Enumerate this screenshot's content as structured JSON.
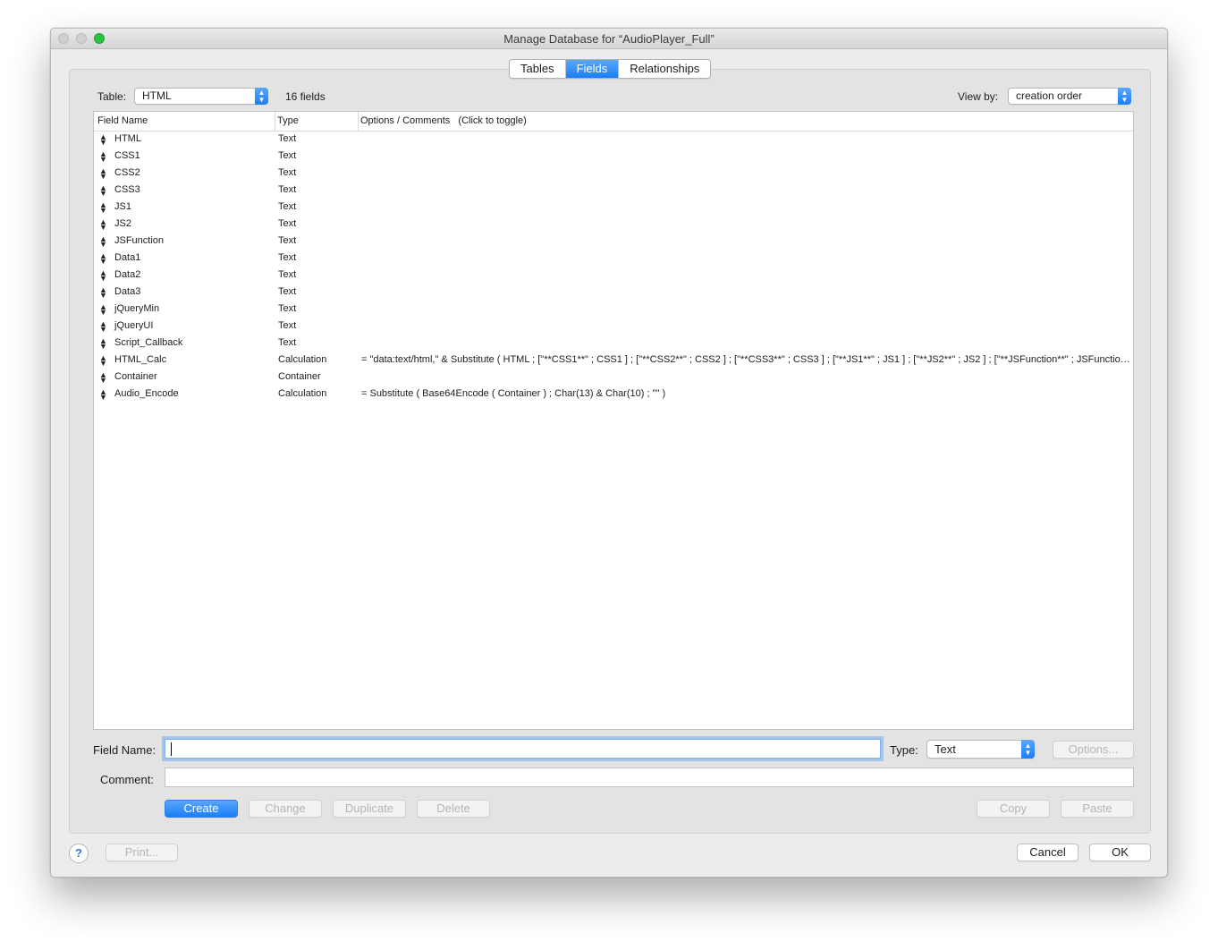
{
  "window": {
    "title": "Manage Database for “AudioPlayer_Full”"
  },
  "tabs": [
    {
      "label": "Tables",
      "active": false
    },
    {
      "label": "Fields",
      "active": true
    },
    {
      "label": "Relationships",
      "active": false
    }
  ],
  "toolbar": {
    "table_label": "Table:",
    "table_value": "HTML",
    "field_count": "16 fields",
    "viewby_label": "View by:",
    "viewby_value": "creation order"
  },
  "columns": {
    "name": "Field Name",
    "type": "Type",
    "options": "Options / Comments   (Click to toggle)"
  },
  "fields": [
    {
      "name": "HTML",
      "type": "Text",
      "options": ""
    },
    {
      "name": "CSS1",
      "type": "Text",
      "options": ""
    },
    {
      "name": "CSS2",
      "type": "Text",
      "options": ""
    },
    {
      "name": "CSS3",
      "type": "Text",
      "options": ""
    },
    {
      "name": "JS1",
      "type": "Text",
      "options": ""
    },
    {
      "name": "JS2",
      "type": "Text",
      "options": ""
    },
    {
      "name": "JSFunction",
      "type": "Text",
      "options": ""
    },
    {
      "name": "Data1",
      "type": "Text",
      "options": ""
    },
    {
      "name": "Data2",
      "type": "Text",
      "options": ""
    },
    {
      "name": "Data3",
      "type": "Text",
      "options": ""
    },
    {
      "name": "jQueryMin",
      "type": "Text",
      "options": ""
    },
    {
      "name": "jQueryUI",
      "type": "Text",
      "options": ""
    },
    {
      "name": "Script_Callback",
      "type": "Text",
      "options": ""
    },
    {
      "name": "HTML_Calc",
      "type": "Calculation",
      "options": "= \"data:text/html,\"  & Substitute (   HTML ; [\"**CSS1**\" ; CSS1 ] ;  [\"**CSS2**\" ; CSS2 ] ;  [\"**CSS3**\" ; CSS3 ] ;   [\"**JS1**\" ; JS1 ] ;  [\"**JS2**\" ; JS2 ] ;  [\"**JSFunction**\" ; JSFunction ]"
    },
    {
      "name": "Container",
      "type": "Container",
      "options": ""
    },
    {
      "name": "Audio_Encode",
      "type": "Calculation",
      "options": "= Substitute ( Base64Encode ( Container ) ; Char(13) & Char(10) ; \"\" )"
    }
  ],
  "form": {
    "field_name_label": "Field Name:",
    "field_name_value": "",
    "type_label": "Type:",
    "type_value": "Text",
    "options_button": "Options...",
    "comment_label": "Comment:",
    "comment_value": ""
  },
  "actions": {
    "create": "Create",
    "change": "Change",
    "duplicate": "Duplicate",
    "delete": "Delete",
    "copy": "Copy",
    "paste": "Paste"
  },
  "footer": {
    "help": "?",
    "print": "Print...",
    "cancel": "Cancel",
    "ok": "OK"
  },
  "colors": {
    "accent": "#1a7ff6"
  }
}
